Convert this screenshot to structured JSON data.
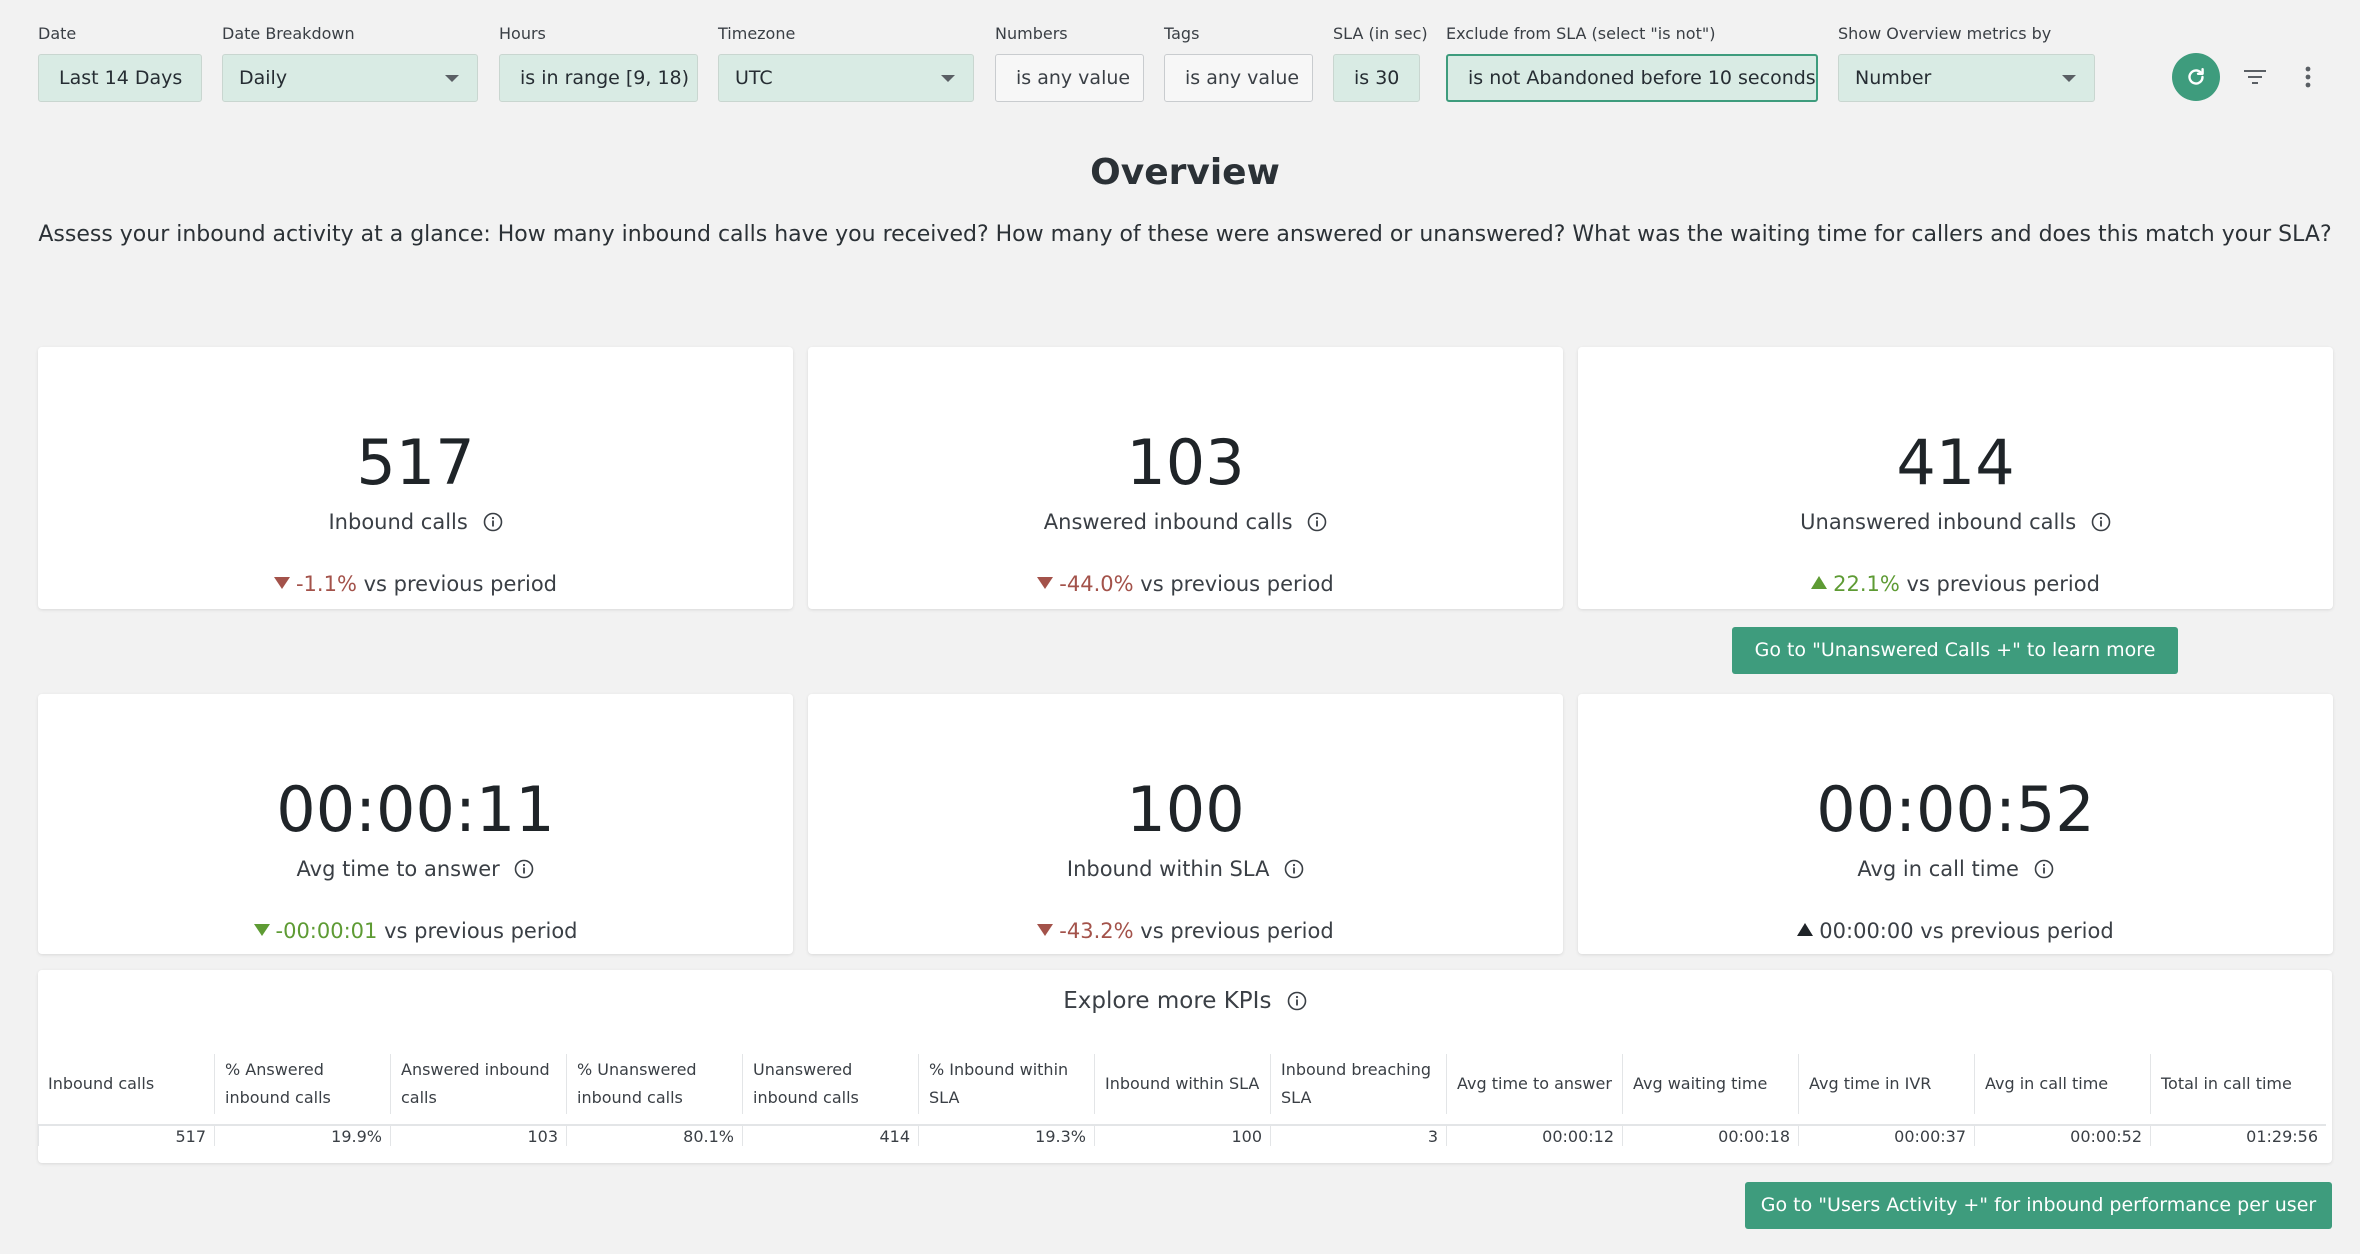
{
  "filters": {
    "date": {
      "label": "Date",
      "value": "Last 14 Days"
    },
    "date_breakdown": {
      "label": "Date Breakdown",
      "value": "Daily"
    },
    "hours": {
      "label": "Hours",
      "value": "is in range [9, 18)"
    },
    "timezone": {
      "label": "Timezone",
      "value": "UTC"
    },
    "numbers": {
      "label": "Numbers",
      "value": "is any value"
    },
    "tags": {
      "label": "Tags",
      "value": "is any value"
    },
    "sla": {
      "label": "SLA (in sec)",
      "value": "is 30"
    },
    "exclude_sla": {
      "label": "Exclude from SLA (select \"is not\")",
      "value": "is not Abandoned before 10 seconds"
    },
    "overview_metrics": {
      "label": "Show Overview metrics by",
      "value": "Number"
    }
  },
  "toolbar_icons": [
    "refresh-icon",
    "filter-icon",
    "more-vertical-icon"
  ],
  "header": {
    "title": "Overview",
    "subtitle": "Assess your inbound activity at a glance: How many inbound calls have you received? How many of these were answered or unanswered? What was the waiting time for callers and does this match your SLA?"
  },
  "cards": {
    "inbound_calls": {
      "value": "517",
      "label": "Inbound calls",
      "delta": "-1.1%",
      "suffix": "vs previous period",
      "trend": "down"
    },
    "answered": {
      "value": "103",
      "label": "Answered inbound calls",
      "delta": "-44.0%",
      "suffix": "vs previous period",
      "trend": "down"
    },
    "unanswered": {
      "value": "414",
      "label": "Unanswered inbound calls",
      "delta": "22.1%",
      "suffix": "vs previous period",
      "trend": "up"
    },
    "avg_answer": {
      "value": "00:00:11",
      "label": "Avg time to answer",
      "delta": "-00:00:01",
      "suffix": "vs previous period",
      "trend": "down"
    },
    "within_sla": {
      "value": "100",
      "label": "Inbound within SLA",
      "delta": "-43.2%",
      "suffix": "vs previous period",
      "trend": "down"
    },
    "avg_call": {
      "value": "00:00:52",
      "label": "Avg in call time",
      "delta": "00:00:00",
      "suffix": "vs previous period",
      "trend": "up"
    }
  },
  "buttons": {
    "unanswered_link": "Go to \"Unanswered Calls +\" to learn more",
    "users_activity_link": "Go to \"Users Activity +\" for inbound performance per user"
  },
  "kpi_table": {
    "title": "Explore more KPIs",
    "headers": [
      "Inbound calls",
      "% Answered inbound calls",
      "Answered inbound calls",
      "% Unanswered inbound calls",
      "Unanswered inbound calls",
      "% Inbound within SLA",
      "Inbound within SLA",
      "Inbound breaching SLA",
      "Avg time to answer",
      "Avg waiting time",
      "Avg time in IVR",
      "Avg in call time",
      "Total in call time"
    ],
    "row": [
      "517",
      "19.9%",
      "103",
      "80.1%",
      "414",
      "19.3%",
      "100",
      "3",
      "00:00:12",
      "00:00:18",
      "00:00:37",
      "00:00:52",
      "01:29:56"
    ]
  },
  "colors": {
    "accent": "#3e9c7d",
    "negative": "#a3524a",
    "positive": "#5e9b34",
    "filter_bg": "#d9ebe4",
    "page_bg": "#f2f2f2"
  }
}
